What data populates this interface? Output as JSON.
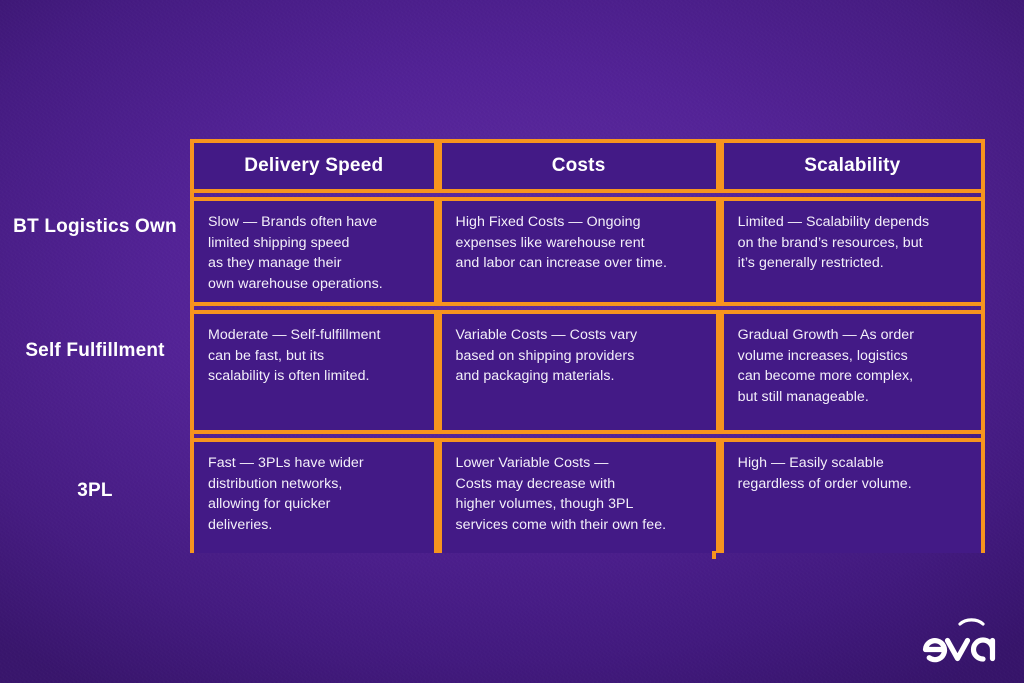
{
  "background": {
    "color": "#4d1f91",
    "cell_color": "#431a86",
    "accent_color": "#f7941e",
    "text_color": "#ffffff"
  },
  "table": {
    "columns": [
      {
        "label": "Delivery Speed"
      },
      {
        "label": "Costs"
      },
      {
        "label": "Scalability"
      }
    ],
    "rows": [
      {
        "label": "BT\nLogistics Own",
        "cells": [
          "Slow — Brands often have\nlimited shipping speed\nas they manage their\nown warehouse operations.",
          "High Fixed Costs — Ongoing\nexpenses like warehouse rent\nand labor can increase over time.",
          "Limited — Scalability depends\non the brand’s resources, but\nit’s generally restricted."
        ]
      },
      {
        "label": "Self\nFulfillment",
        "cells": [
          "Moderate — Self-fulfillment\ncan be fast, but its\nscalability is often limited.",
          "Variable Costs — Costs vary\nbased on shipping providers\nand packaging materials.",
          "Gradual Growth — As order\nvolume increases, logistics\ncan become more complex,\nbut still manageable."
        ]
      },
      {
        "label": "3PL",
        "cells": [
          " Fast — 3PLs have wider\ndistribution networks,\nallowing for quicker\ndeliveries.",
          "Lower Variable Costs —\nCosts may decrease with\nhigher volumes, though 3PL\nservices come with their own fee.",
          "High — Easily scalable\nregardless of order volume."
        ]
      }
    ]
  },
  "logo": {
    "name": "eva",
    "wordmark": "eva"
  }
}
